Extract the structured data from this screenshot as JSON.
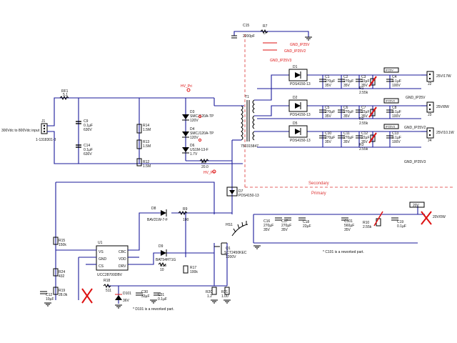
{
  "input": {
    "label": "300Vdc to 800Vdc input",
    "connector": "J1",
    "part": "1-1318301-3"
  },
  "labels": {
    "secondary": "Secondary",
    "primary": "Primary",
    "hv_pri": "HV_Pri",
    "gnd_ip25v": "GND_IP25V",
    "gnd_ip25v2": "GND_IP25V2",
    "gnd_ip25v3": "GND_IP25V3",
    "note_c101": "* C101 is a reworked part.",
    "note_d101": "* D101 is a reworked part."
  },
  "outputs": [
    {
      "net": "IP25V",
      "label": "25V/17W",
      "connector": "J2"
    },
    {
      "net": "IP25V2",
      "label": "25V/8W",
      "connector": "J3"
    },
    {
      "net": "IP25V3",
      "label": "25V/10.1W",
      "connector": "J4"
    },
    {
      "net": "20V",
      "label": "20V/0W"
    }
  ],
  "components": {
    "rf1": {
      "ref": "RF1",
      "val": "5.1"
    },
    "c9": {
      "ref": "C9",
      "val": "0.1µF",
      "v": "630V"
    },
    "c14": {
      "ref": "C14",
      "val": "0.1µF",
      "v": "630V"
    },
    "r14": {
      "ref": "R14",
      "val": "1.5M"
    },
    "r13": {
      "ref": "R13",
      "val": "1.5M"
    },
    "r12": {
      "ref": "R12",
      "val": "1.5M"
    },
    "d3": {
      "ref": "D3",
      "part": "SMCJ120A-TP",
      "v": "120V"
    },
    "d4": {
      "ref": "D4",
      "part": "SMCJ120A-TP",
      "v": "120V"
    },
    "d6": {
      "ref": "D6",
      "part": "US1M-13-F",
      "v": "1.7V"
    },
    "r8": {
      "ref": "R8",
      "val": "20.0"
    },
    "t1": {
      "ref": "T1",
      "part": "750315847"
    },
    "d1": {
      "ref": "D1",
      "part": "PDS4150-13"
    },
    "d2": {
      "ref": "D2",
      "part": "PDS4150-13"
    },
    "d5": {
      "ref": "D5",
      "part": "PDS4150-13"
    },
    "d7": {
      "ref": "D7",
      "part": "PDS4150-13"
    },
    "c15": {
      "ref": "C15",
      "val": "2200pF"
    },
    "r7": {
      "ref": "R7",
      "val": "0"
    },
    "d8": {
      "ref": "D8",
      "part": "BAV21W-7-F"
    },
    "r9": {
      "ref": "R9",
      "val": "100"
    },
    "d9": {
      "ref": "D9",
      "part": "BAT54HT1G"
    },
    "r16": {
      "ref": "R16",
      "val": "10"
    },
    "r17": {
      "ref": "R17",
      "val": "100k"
    },
    "r15": {
      "ref": "R15",
      "val": "150k"
    },
    "r24": {
      "ref": "R24",
      "val": "432"
    },
    "r19": {
      "ref": "R19",
      "val": "28.0k"
    },
    "r18": {
      "ref": "R18",
      "val": "511"
    },
    "c12": {
      "ref": "C12",
      "val": "10µF"
    },
    "u1": {
      "ref": "U1",
      "part": "UCC28700DBV",
      "pins": [
        "VS",
        "GND",
        "CS",
        "CBC",
        "VDD",
        "DRV"
      ]
    },
    "q1": {
      "ref": "Q1",
      "part": "SCT2450KEC",
      "v": "1200V"
    },
    "hs1": {
      "ref": "HS1"
    },
    "d101": {
      "ref": "D101",
      "v": "36V"
    },
    "c30": {
      "ref": "C30",
      "val": "33µF"
    },
    "c31": {
      "ref": "C31",
      "val": "0.1µF"
    },
    "r20": {
      "ref": "R20",
      "val": "1.2"
    },
    "r21": {
      "ref": "R21",
      "val": "1.00"
    },
    "c16": {
      "ref": "C16",
      "val": "270µF",
      "v": "35V"
    },
    "c17": {
      "ref": "C17",
      "val": "270µF",
      "v": "35V"
    },
    "c18": {
      "ref": "C18",
      "val": "22µF"
    },
    "c101": {
      "ref": "C101",
      "val": "560µF",
      "v": "35V"
    },
    "r10": {
      "ref": "R10",
      "val": "2.55k"
    },
    "c19": {
      "ref": "C19",
      "val": "0.1µF"
    }
  },
  "out_caps": [
    {
      "row": "1",
      "c1": "C1",
      "c2": "C2",
      "c3": "C3",
      "c4": "C4",
      "r": "R1",
      "v270": "270µF",
      "v35": "35V",
      "v22": "22µF",
      "v01": "0.1µF",
      "v100": "100V",
      "rv": "2.55k"
    },
    {
      "row": "2",
      "c1": "C5",
      "c2": "C6",
      "c3": "C7",
      "c4": "C8",
      "r": "R2",
      "v270": "270µF",
      "v35": "35V",
      "v22": "22µF",
      "v01": "0.1µF",
      "v100": "100V",
      "rv": "2.55k"
    },
    {
      "row": "3",
      "c1": "C10",
      "c2": "C11",
      "c3": "C12",
      "c4": "C13",
      "r": "R3",
      "v270": "270µF",
      "v35": "35V",
      "v22": "22µF",
      "v01": "0.1µF",
      "v100": "100V",
      "rv": "2.55k"
    }
  ],
  "colors": {
    "wire": "#1a1a9a",
    "rework": "#dd1111",
    "dnp": "#dd1111"
  }
}
